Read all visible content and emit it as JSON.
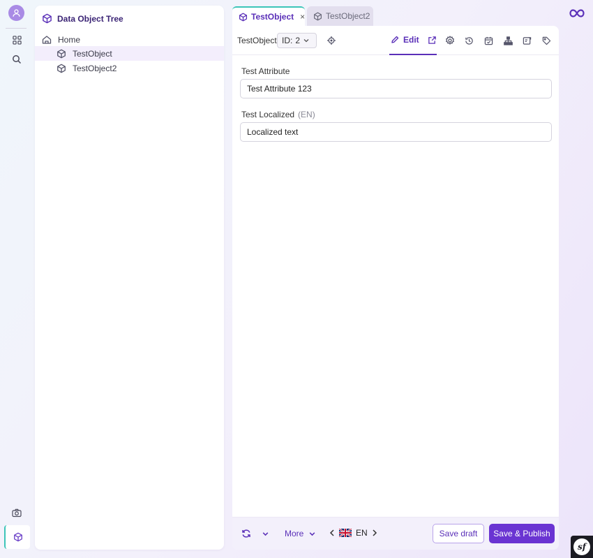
{
  "colors": {
    "accent": "#5a2fb8",
    "accent_button": "#6a34d2",
    "tab_indicator": "#3cc5b8",
    "avatar": "#a98be5"
  },
  "rail": {
    "items": [
      {
        "icon": "user-avatar-icon"
      },
      {
        "icon": "dashboard-grid-icon"
      },
      {
        "icon": "search-icon"
      },
      {
        "icon": "camera-icon"
      },
      {
        "icon": "data-object-cube-icon"
      }
    ]
  },
  "tree": {
    "title": "Data Object Tree",
    "title_icon": "cube-icon",
    "items": [
      {
        "label": "Home",
        "icon": "home-icon",
        "level": 0
      },
      {
        "label": "TestObject",
        "icon": "cube-icon",
        "level": 1,
        "selected": true
      },
      {
        "label": "TestObject2",
        "icon": "cube-icon",
        "level": 1
      }
    ]
  },
  "tabs": [
    {
      "label": "TestObject",
      "active": true,
      "icon": "cube-icon",
      "close_label": "×"
    },
    {
      "label": "TestObject2",
      "active": false,
      "icon": "cube-icon"
    }
  ],
  "toolbar": {
    "object_label": "TestObject",
    "id_label": "ID:",
    "id_value": "2",
    "locate_icon": "crosshair-icon",
    "edit_label": "Edit",
    "icons": [
      "external-link-icon",
      "gear-icon",
      "history-icon",
      "calendar-check-icon",
      "hierarchy-icon",
      "notes-icon",
      "tag-icon"
    ]
  },
  "fields": [
    {
      "label": "Test Attribute",
      "suffix": "",
      "value": "Test Attribute 123"
    },
    {
      "label": "Test Localized",
      "suffix": "(EN)",
      "value": "Localized text"
    }
  ],
  "footer": {
    "more_label": "More",
    "language": "EN",
    "save_draft_label": "Save draft",
    "save_publish_label": "Save & Publish",
    "badge_label": "sf"
  }
}
